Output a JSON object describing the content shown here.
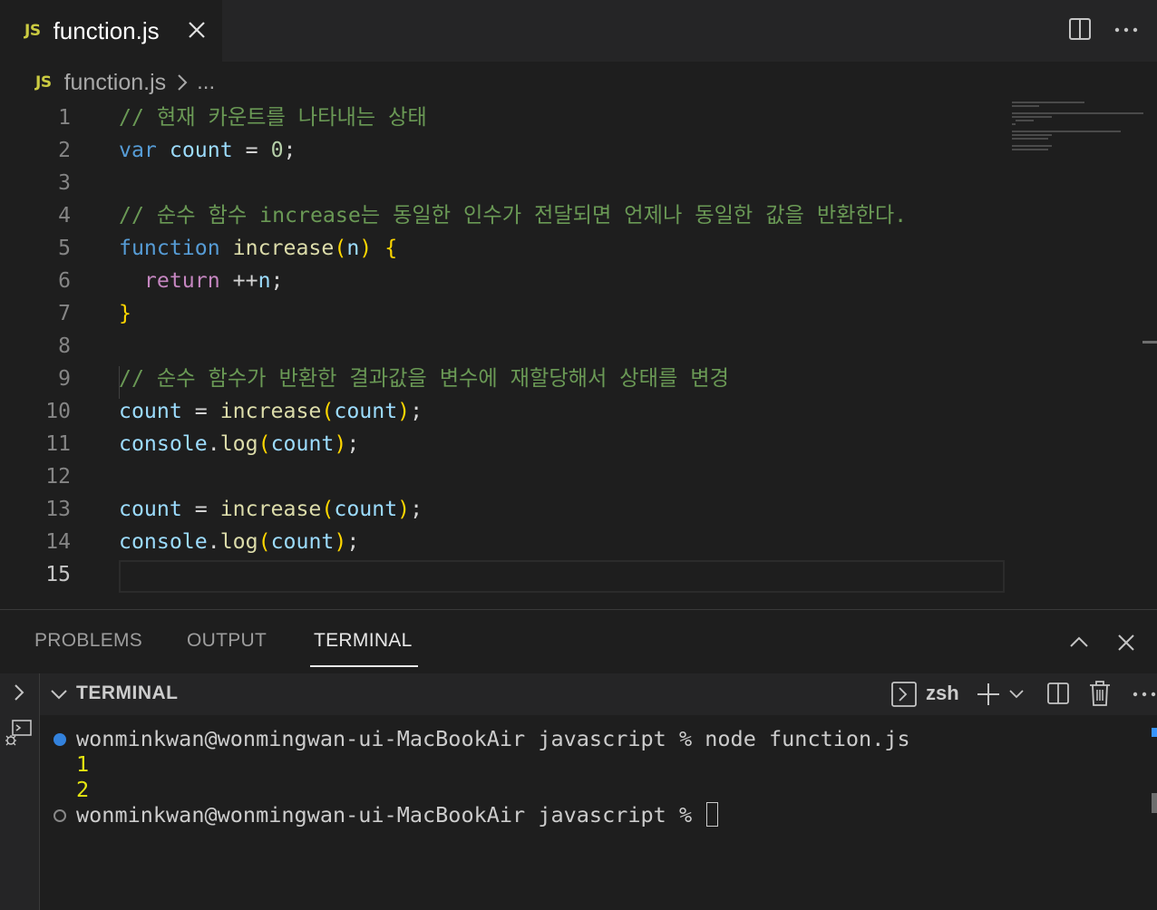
{
  "tab": {
    "badge": "JS",
    "label": "function.js"
  },
  "breadcrumb": {
    "badge": "JS",
    "file": "function.js",
    "more": "..."
  },
  "editor": {
    "lines": [
      {
        "num": "1",
        "tokens": [
          {
            "t": "// 현재 카운트를 나타내는 상태",
            "c": "comment"
          }
        ]
      },
      {
        "num": "2",
        "tokens": [
          {
            "t": "var",
            "c": "kw"
          },
          {
            "t": " ",
            "c": "op"
          },
          {
            "t": "count",
            "c": "var"
          },
          {
            "t": " = ",
            "c": "op"
          },
          {
            "t": "0",
            "c": "num"
          },
          {
            "t": ";",
            "c": "op"
          }
        ]
      },
      {
        "num": "3",
        "tokens": []
      },
      {
        "num": "4",
        "tokens": [
          {
            "t": "// 순수 함수 increase는 동일한 인수가 전달되면 언제나 동일한 값을 반환한다.",
            "c": "comment"
          }
        ]
      },
      {
        "num": "5",
        "tokens": [
          {
            "t": "function",
            "c": "kw"
          },
          {
            "t": " ",
            "c": "op"
          },
          {
            "t": "increase",
            "c": "fn"
          },
          {
            "t": "(",
            "c": "p1"
          },
          {
            "t": "n",
            "c": "var"
          },
          {
            "t": ")",
            "c": "p1"
          },
          {
            "t": " ",
            "c": "op"
          },
          {
            "t": "{",
            "c": "p1"
          }
        ]
      },
      {
        "num": "6",
        "tokens": [
          {
            "t": "  ",
            "c": "op"
          },
          {
            "t": "return",
            "c": "ctl"
          },
          {
            "t": " ++",
            "c": "op"
          },
          {
            "t": "n",
            "c": "var"
          },
          {
            "t": ";",
            "c": "op"
          }
        ]
      },
      {
        "num": "7",
        "tokens": [
          {
            "t": "}",
            "c": "p1"
          }
        ]
      },
      {
        "num": "8",
        "tokens": []
      },
      {
        "num": "9",
        "tokens": [
          {
            "t": "// 순수 함수가 반환한 결과값을 변수에 재할당해서 상태를 변경",
            "c": "comment"
          }
        ]
      },
      {
        "num": "10",
        "tokens": [
          {
            "t": "count",
            "c": "var"
          },
          {
            "t": " = ",
            "c": "op"
          },
          {
            "t": "increase",
            "c": "fn"
          },
          {
            "t": "(",
            "c": "p1"
          },
          {
            "t": "count",
            "c": "var"
          },
          {
            "t": ")",
            "c": "p1"
          },
          {
            "t": ";",
            "c": "op"
          }
        ]
      },
      {
        "num": "11",
        "tokens": [
          {
            "t": "console",
            "c": "var"
          },
          {
            "t": ".",
            "c": "op"
          },
          {
            "t": "log",
            "c": "fn"
          },
          {
            "t": "(",
            "c": "p1"
          },
          {
            "t": "count",
            "c": "var"
          },
          {
            "t": ")",
            "c": "p1"
          },
          {
            "t": ";",
            "c": "op"
          }
        ]
      },
      {
        "num": "12",
        "tokens": []
      },
      {
        "num": "13",
        "tokens": [
          {
            "t": "count",
            "c": "var"
          },
          {
            "t": " = ",
            "c": "op"
          },
          {
            "t": "increase",
            "c": "fn"
          },
          {
            "t": "(",
            "c": "p1"
          },
          {
            "t": "count",
            "c": "var"
          },
          {
            "t": ")",
            "c": "p1"
          },
          {
            "t": ";",
            "c": "op"
          }
        ]
      },
      {
        "num": "14",
        "tokens": [
          {
            "t": "console",
            "c": "var"
          },
          {
            "t": ".",
            "c": "op"
          },
          {
            "t": "log",
            "c": "fn"
          },
          {
            "t": "(",
            "c": "p1"
          },
          {
            "t": "count",
            "c": "var"
          },
          {
            "t": ")",
            "c": "p1"
          },
          {
            "t": ";",
            "c": "op"
          }
        ]
      },
      {
        "num": "15",
        "tokens": []
      }
    ],
    "active_line": "15"
  },
  "panel": {
    "tabs": [
      {
        "label": "PROBLEMS",
        "active": false
      },
      {
        "label": "OUTPUT",
        "active": false
      },
      {
        "label": "TERMINAL",
        "active": true
      }
    ]
  },
  "terminal": {
    "title": "TERMINAL",
    "shell": "zsh",
    "lines": [
      {
        "kind": "prompt",
        "status": "done",
        "text": "wonminkwan@wonmingwan-ui-MacBookAir javascript % node function.js"
      },
      {
        "kind": "output",
        "text": "1"
      },
      {
        "kind": "output",
        "text": "2"
      },
      {
        "kind": "prompt",
        "status": "idle",
        "text": "wonminkwan@wonmingwan-ui-MacBookAir javascript % "
      }
    ]
  },
  "colors": {
    "comment": "#6a9955",
    "keyword": "#569cd6",
    "variable": "#9cdcfe",
    "number": "#b5cea8",
    "function": "#dcdcaa",
    "control": "#c586c0",
    "bracket": "#ffd700",
    "js_badge": "#cbcb41",
    "terminal_output": "#e5e510"
  }
}
